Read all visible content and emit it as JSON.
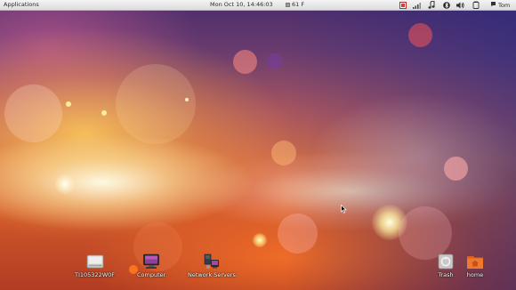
{
  "top_panel": {
    "applications_label": "Applications",
    "clock": "Mon Oct 10, 14:46:03",
    "weather_temp": "61 F",
    "user_name": "Tom",
    "tray_icons": [
      "screenshot-icon",
      "network-signal-icon",
      "music-note-icon",
      "bluetooth-icon",
      "volume-icon",
      "power-icon",
      "chat-icon"
    ]
  },
  "desktop": {
    "icons": [
      {
        "label": "TI105322W0F",
        "icon": "drive-icon"
      },
      {
        "label": "Computer",
        "icon": "computer-icon"
      },
      {
        "label": "Network Servers",
        "icon": "network-servers-icon"
      },
      {
        "label": "Trash",
        "icon": "trash-icon"
      },
      {
        "label": "home",
        "icon": "home-folder-icon"
      }
    ]
  },
  "colors": {
    "panel_bg": "#e6e6e6",
    "panel_text": "#2b2b2b",
    "wallpaper_warm": "#d06d48",
    "wallpaper_cool": "#2d3b8a",
    "folder_orange": "#f0782c"
  }
}
